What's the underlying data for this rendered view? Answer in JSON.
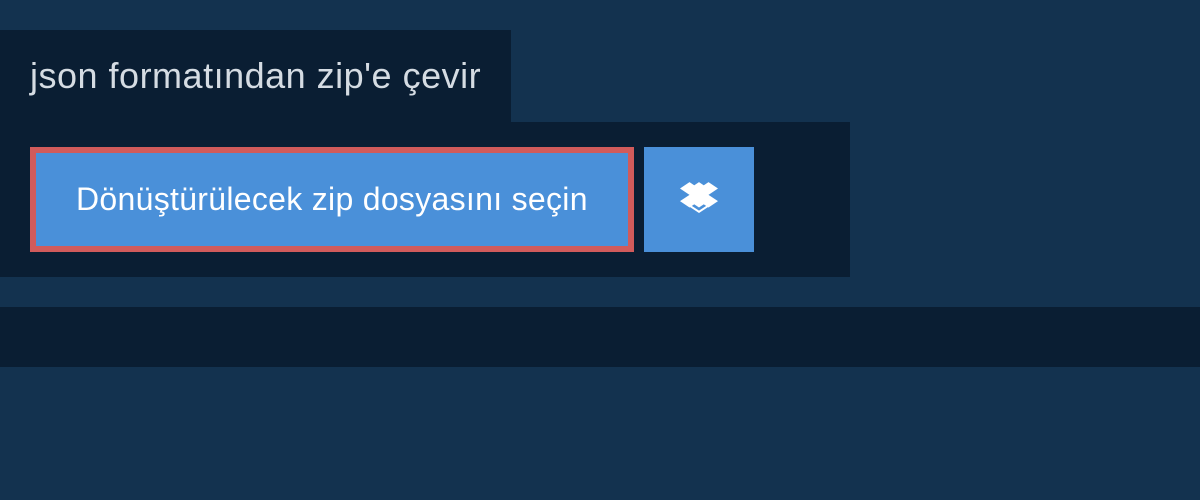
{
  "header": {
    "title": "json formatından zip'e çevir"
  },
  "upload": {
    "select_label": "Dönüştürülecek zip dosyasını seçin",
    "dropbox_icon": "dropbox-icon"
  },
  "colors": {
    "background": "#13324f",
    "panel": "#0a1e33",
    "button": "#4a90d9",
    "highlight_border": "#d15b5b",
    "text_light": "#d5dce3"
  }
}
